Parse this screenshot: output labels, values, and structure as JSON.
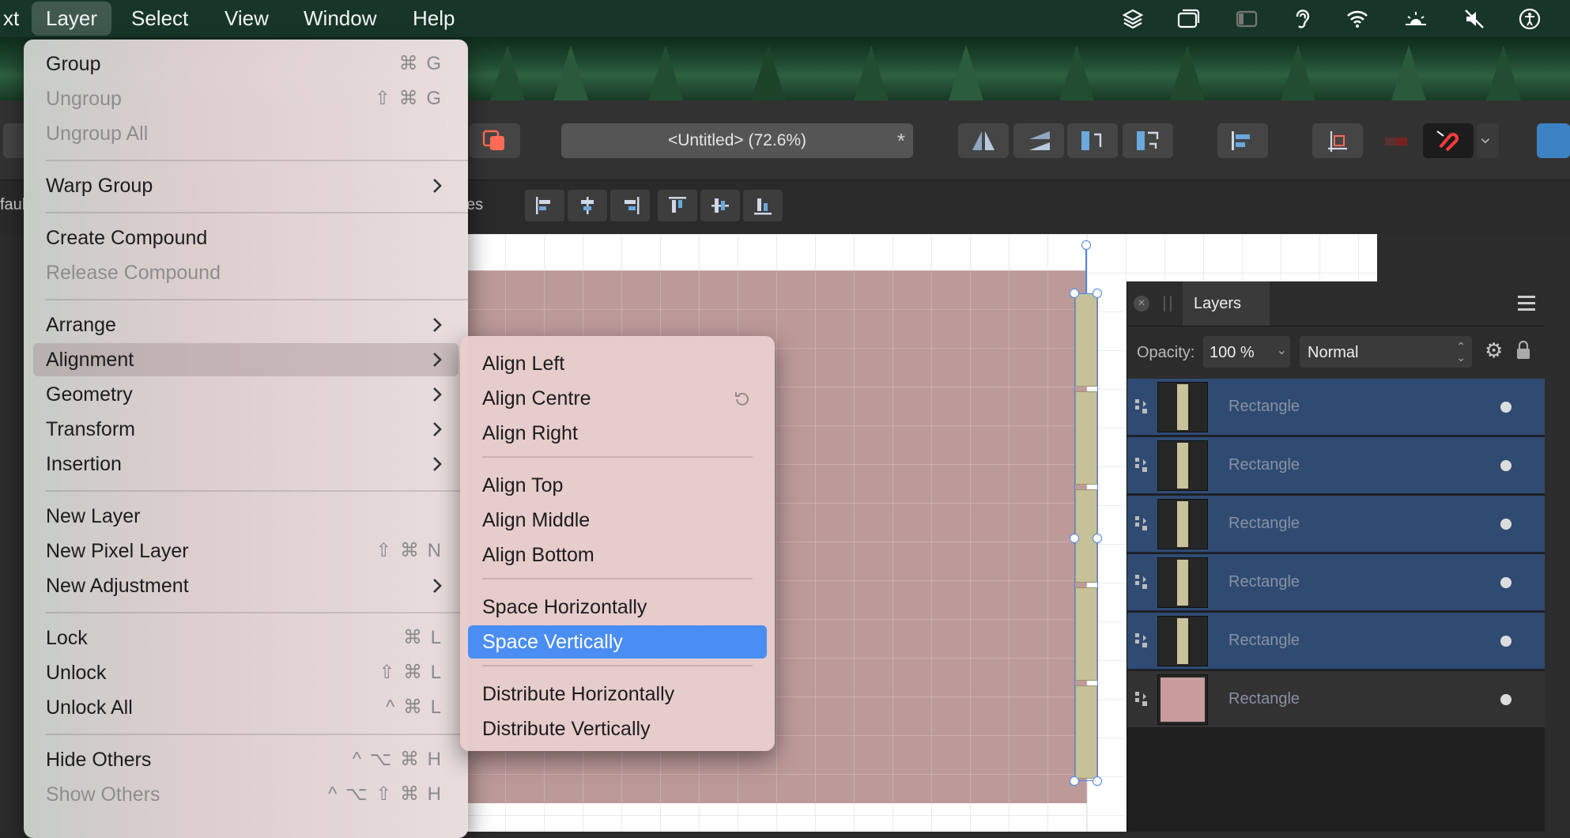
{
  "menubar": {
    "items": [
      {
        "label": "xt"
      },
      {
        "label": "Layer"
      },
      {
        "label": "Select"
      },
      {
        "label": "View"
      },
      {
        "label": "Window"
      },
      {
        "label": "Help"
      }
    ],
    "status_icons": [
      "layers-icon",
      "window-icon",
      "sidebar-icon",
      "hearing-icon",
      "wifi-icon",
      "brightness-icon",
      "mute-icon",
      "accessibility-icon"
    ]
  },
  "toolbar": {
    "document_title": "<Untitled> (72.6%)",
    "modified_marker": "*"
  },
  "contextbar": {
    "left_fragment": "faul",
    "mid_fragment": "es"
  },
  "layer_menu": {
    "items": [
      {
        "label": "Group",
        "shortcut": "⌘ G",
        "disabled": false
      },
      {
        "label": "Ungroup",
        "shortcut": "⇧ ⌘ G",
        "disabled": true
      },
      {
        "label": "Ungroup All",
        "shortcut": "",
        "disabled": true
      },
      {
        "label": "Warp Group",
        "submenu": true
      },
      {
        "label": "Create Compound",
        "shortcut": ""
      },
      {
        "label": "Release Compound",
        "disabled": true
      },
      {
        "label": "Arrange",
        "submenu": true
      },
      {
        "label": "Alignment",
        "submenu": true,
        "hover": true
      },
      {
        "label": "Geometry",
        "submenu": true
      },
      {
        "label": "Transform",
        "submenu": true
      },
      {
        "label": "Insertion",
        "submenu": true
      },
      {
        "label": "New Layer",
        "shortcut": ""
      },
      {
        "label": "New Pixel Layer",
        "shortcut": "⇧ ⌘ N"
      },
      {
        "label": "New Adjustment",
        "submenu": true
      },
      {
        "label": "Lock",
        "shortcut": "⌘ L"
      },
      {
        "label": "Unlock",
        "shortcut": "⇧ ⌘ L"
      },
      {
        "label": "Unlock All",
        "shortcut": "^ ⌘ L"
      },
      {
        "label": "Hide Others",
        "shortcut": "^ ⌥ ⌘ H"
      },
      {
        "label": "Show Others",
        "shortcut": "^ ⌥ ⇧ ⌘ H",
        "disabled": true
      }
    ]
  },
  "alignment_menu": {
    "items": [
      {
        "label": "Align Left"
      },
      {
        "label": "Align Centre"
      },
      {
        "label": "Align Right"
      },
      {
        "label": "Align Top"
      },
      {
        "label": "Align Middle"
      },
      {
        "label": "Align Bottom"
      },
      {
        "label": "Space Horizontally"
      },
      {
        "label": "Space Vertically",
        "selected": true
      },
      {
        "label": "Distribute Horizontally"
      },
      {
        "label": "Distribute Vertically"
      }
    ]
  },
  "layers_panel": {
    "tab_label": "Layers",
    "opacity_label": "Opacity:",
    "opacity_value": "100 %",
    "blend_mode": "Normal",
    "layers": [
      {
        "name": "Rectangle",
        "selected": true,
        "thumb": "bar"
      },
      {
        "name": "Rectangle",
        "selected": true,
        "thumb": "bar"
      },
      {
        "name": "Rectangle",
        "selected": true,
        "thumb": "bar"
      },
      {
        "name": "Rectangle",
        "selected": true,
        "thumb": "bar"
      },
      {
        "name": "Rectangle",
        "selected": true,
        "thumb": "bar"
      },
      {
        "name": "Rectangle",
        "selected": false,
        "thumb": "pink"
      }
    ]
  },
  "colors": {
    "menubar_bg": "#173629",
    "selection_blue": "#4a8ef3",
    "layer_selected": "#304b72",
    "canvas_rect": "#bd9a9a",
    "small_rect": "#c6c199"
  }
}
